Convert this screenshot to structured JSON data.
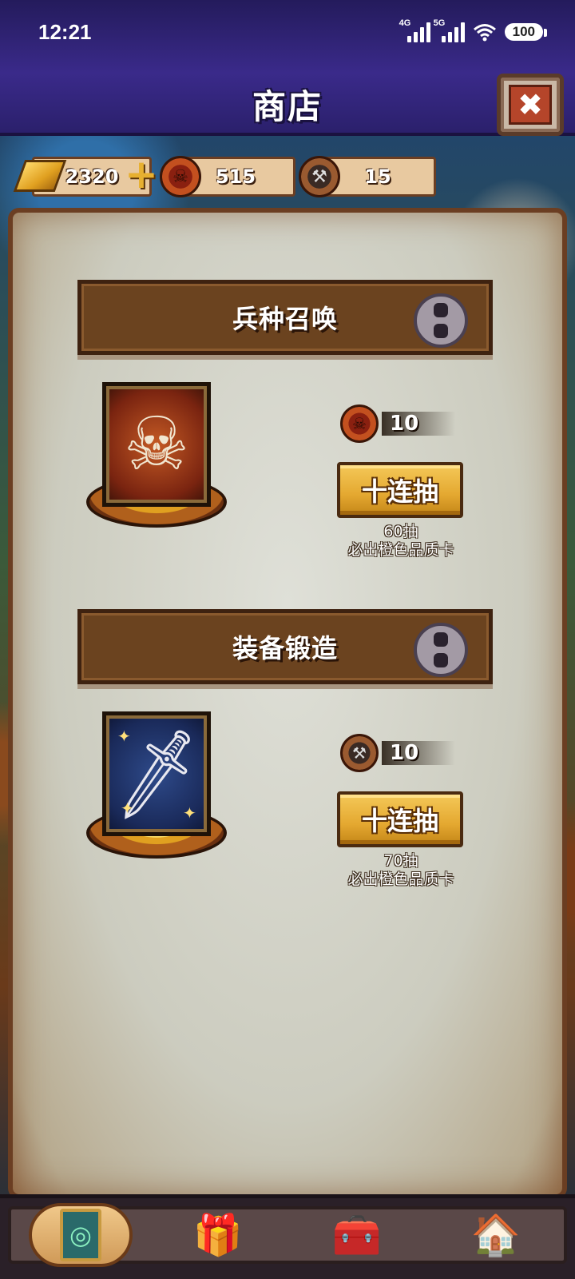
{
  "status_bar": {
    "time": "12:21",
    "signal1_label": "4G",
    "signal2_label": "5G",
    "battery": "100"
  },
  "header": {
    "title": "商店",
    "close_symbol": "✖"
  },
  "resources": {
    "gold": "2320",
    "summon_tokens": "515",
    "forge_tokens": "15",
    "plus_symbol": "+"
  },
  "sections": [
    {
      "title": "兵种召唤",
      "price": "10",
      "button_label": "十连抽",
      "note_line1": "60抽",
      "note_line2": "必出橙色品质卡",
      "image_icon": "skeleton-warrior-icon",
      "currency_icon": "demon-coin-icon"
    },
    {
      "title": "装备锻造",
      "price": "10",
      "button_label": "十连抽",
      "note_line1": "70抽",
      "note_line2": "必出橙色品质卡",
      "image_icon": "sword-icon",
      "currency_icon": "anvil-coin-icon"
    }
  ],
  "bottom_nav": {
    "items": [
      {
        "icon": "card-icon",
        "active": true
      },
      {
        "icon": "gift-icon",
        "active": false
      },
      {
        "icon": "treasure-chest-icon",
        "active": false
      },
      {
        "icon": "barracks-icon",
        "active": false
      }
    ]
  },
  "colors": {
    "header": "#3a2a8a",
    "banner": "#6b431f",
    "button": "#e4a830",
    "parchment": "#d6d6cc"
  }
}
